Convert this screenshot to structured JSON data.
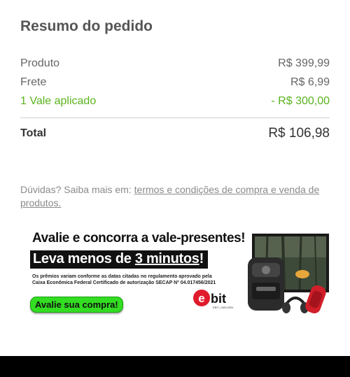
{
  "summary": {
    "title": "Resumo do pedido",
    "product_label": "Produto",
    "product_value": "R$ 399,99",
    "shipping_label": "Frete",
    "shipping_value": "R$ 6,99",
    "voucher_label": "1 Vale aplicado",
    "voucher_value": "- R$ 300,00",
    "total_label": "Total",
    "total_value": "R$ 106,98"
  },
  "help": {
    "prefix": "Dúvidas? Saiba mais em: ",
    "link": "termos e condições de compra e venda de produtos."
  },
  "banner": {
    "headline": "Avalie e concorra a vale-presentes!",
    "box_prefix": "Leva menos de ",
    "box_highlight": "3 minutos",
    "box_suffix": "!",
    "fine_print": "Os prêmios variam conforme as datas citadas no regulamento aprovado pela Caixa Econômica Federal Certificado de autorização SECAP Nº 04.017456/2021",
    "button": "Avalie sua compra!",
    "logo_text": "ebit",
    "logo_sub": "EBIT | NIELSEN"
  },
  "colors": {
    "green": "#5ab31e",
    "button_green": "#33dd22",
    "logo_red": "#e01b2b"
  }
}
